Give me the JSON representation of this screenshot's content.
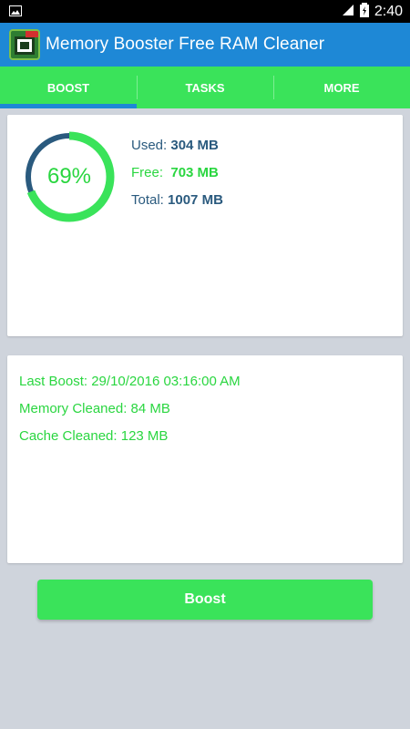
{
  "status_bar": {
    "time": "2:40"
  },
  "app": {
    "title": "Memory Booster Free RAM Cleaner"
  },
  "tabs": [
    {
      "label": "BOOST",
      "selected": true
    },
    {
      "label": "TASKS",
      "selected": false
    },
    {
      "label": "MORE",
      "selected": false
    }
  ],
  "memory": {
    "percent_label": "69%",
    "used_fraction": 0.69,
    "used_label": "Used:",
    "used_value": "304 MB",
    "free_label": "Free:",
    "free_value": "703 MB",
    "total_label": "Total:",
    "total_value": "1007 MB"
  },
  "info": {
    "last_boost": "Last Boost: 29/10/2016 03:16:00 AM",
    "memory_cleaned": "Memory Cleaned: 84 MB",
    "cache_cleaned": "Cache Cleaned: 123 MB"
  },
  "boost_button": {
    "label": "Boost"
  },
  "colors": {
    "accent_green": "#3ae35a",
    "action_bar_blue": "#1e88d6",
    "ring_track": "#2a5a7e",
    "text_navy": "#2a5a7e",
    "background": "#cfd4dc"
  }
}
